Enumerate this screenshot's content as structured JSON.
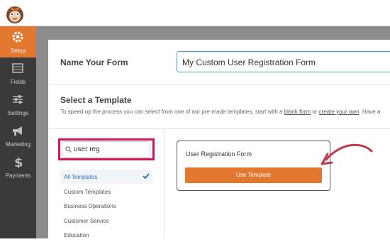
{
  "sidebar": {
    "items": [
      {
        "label": "Setup",
        "icon": "gear-icon"
      },
      {
        "label": "Fields",
        "icon": "fields-icon"
      },
      {
        "label": "Settings",
        "icon": "sliders-icon"
      },
      {
        "label": "Marketing",
        "icon": "megaphone-icon"
      },
      {
        "label": "Payments",
        "icon": "dollar-icon"
      }
    ]
  },
  "form_name": {
    "label": "Name Your Form",
    "value": "My Custom User Registration Form"
  },
  "template": {
    "title": "Select a Template",
    "desc_start": "To speed up the process you can select from one of our pre-made templates, start with a",
    "blank_link": "blank form",
    "or_text": "or",
    "create_link": "create your own",
    "desc_end": ". Have a"
  },
  "search": {
    "value": "user reg"
  },
  "categories": [
    "All Templates",
    "Custom Templates",
    "Business Operations",
    "Customer Service",
    "Education"
  ],
  "card": {
    "title": "User Registration Form",
    "button": "Use Template"
  },
  "colors": {
    "accent": "#e27730",
    "sidebar": "#3a3a3a",
    "highlight": "#d4145a",
    "arrow": "#c0394a"
  }
}
